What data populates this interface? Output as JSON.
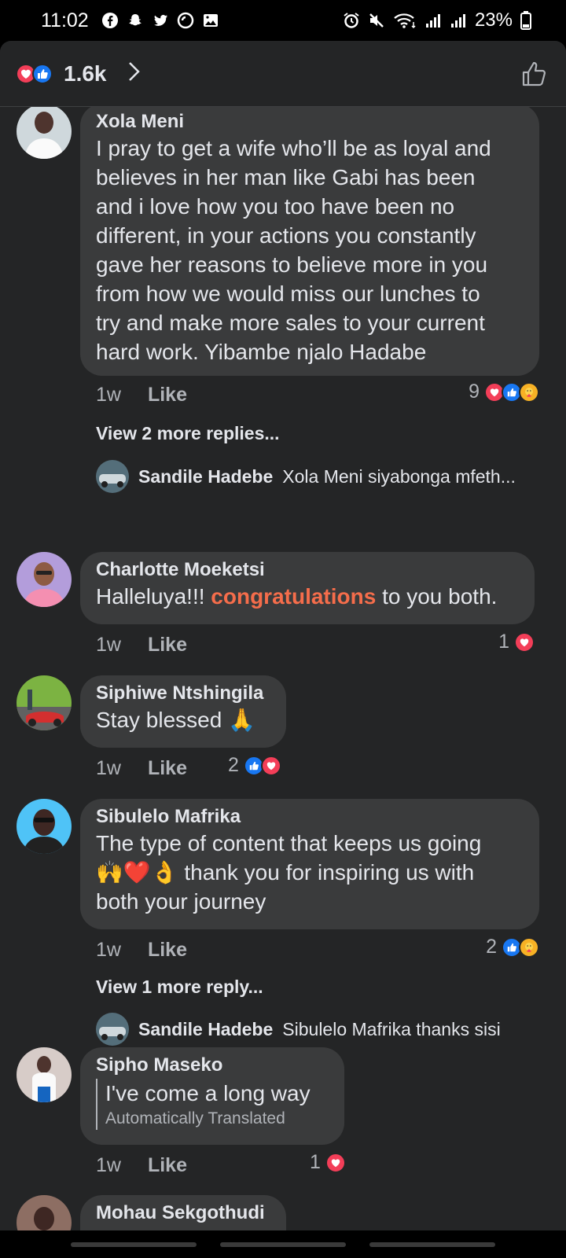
{
  "status": {
    "time": "11:02",
    "battery": "23%",
    "left_icons": [
      "facebook-icon",
      "snapchat-icon",
      "twitter-icon",
      "opera-icon",
      "gallery-icon"
    ],
    "right_icons": [
      "alarm-icon",
      "mute-icon",
      "wifi-icon",
      "signal-icon",
      "signal-icon",
      "battery-icon"
    ]
  },
  "header": {
    "reaction_count": "1.6k",
    "reactions": [
      "love",
      "like"
    ]
  },
  "colors": {
    "background": "#242526",
    "bubble": "#3a3b3c",
    "like_blue": "#1877f2",
    "love_red": "#f33e58",
    "highlight_orange": "#f56d4b"
  },
  "comments": [
    {
      "author": "Xola Meni",
      "lines": [
        "I pray to get a wife who’ll be as loyal and",
        "believes in her man like Gabi has been",
        "and i love how you too have been no",
        "different, in your actions you constantly",
        "gave her reasons to believe more in you",
        "from how we would miss our lunches to",
        "try and make more sales to your current",
        "hard work. Yibambe njalo Hadabe"
      ],
      "time": "1w",
      "like_label": "Like",
      "reaction_count": "9",
      "reactions": [
        "love",
        "like",
        "care"
      ],
      "view_more": "View 2 more replies...",
      "reply": {
        "author": "Sandile Hadebe",
        "text": "Xola Meni siyabonga mfeth..."
      }
    },
    {
      "author": "Charlotte Moeketsi",
      "text_before": "Halleluya!!! ",
      "text_highlight": "congratulations",
      "text_after": " to you both.",
      "time": "1w",
      "like_label": "Like",
      "reaction_count": "1",
      "reactions": [
        "love"
      ]
    },
    {
      "author": "Siphiwe Ntshingila",
      "text": "Stay blessed 🙏",
      "time": "1w",
      "like_label": "Like",
      "reaction_count": "2",
      "reactions": [
        "like",
        "love"
      ]
    },
    {
      "author": "Sibulelo Mafrika",
      "lines": [
        "The type of content that keeps us going",
        "🙌❤️👌 thank you for inspiring us with",
        "both your journey"
      ],
      "time": "1w",
      "like_label": "Like",
      "reaction_count": "2",
      "reactions": [
        "like",
        "care"
      ],
      "view_more": "View 1 more reply...",
      "reply": {
        "author": "Sandile Hadebe",
        "text": "Sibulelo Mafrika thanks sisi"
      }
    },
    {
      "author": "Sipho Maseko",
      "text": "I've come a long way",
      "translated_label": "Automatically Translated",
      "time": "1w",
      "like_label": "Like",
      "reaction_count": "1",
      "reactions": [
        "love"
      ]
    },
    {
      "author": "Mohau Sekgothudi"
    }
  ]
}
